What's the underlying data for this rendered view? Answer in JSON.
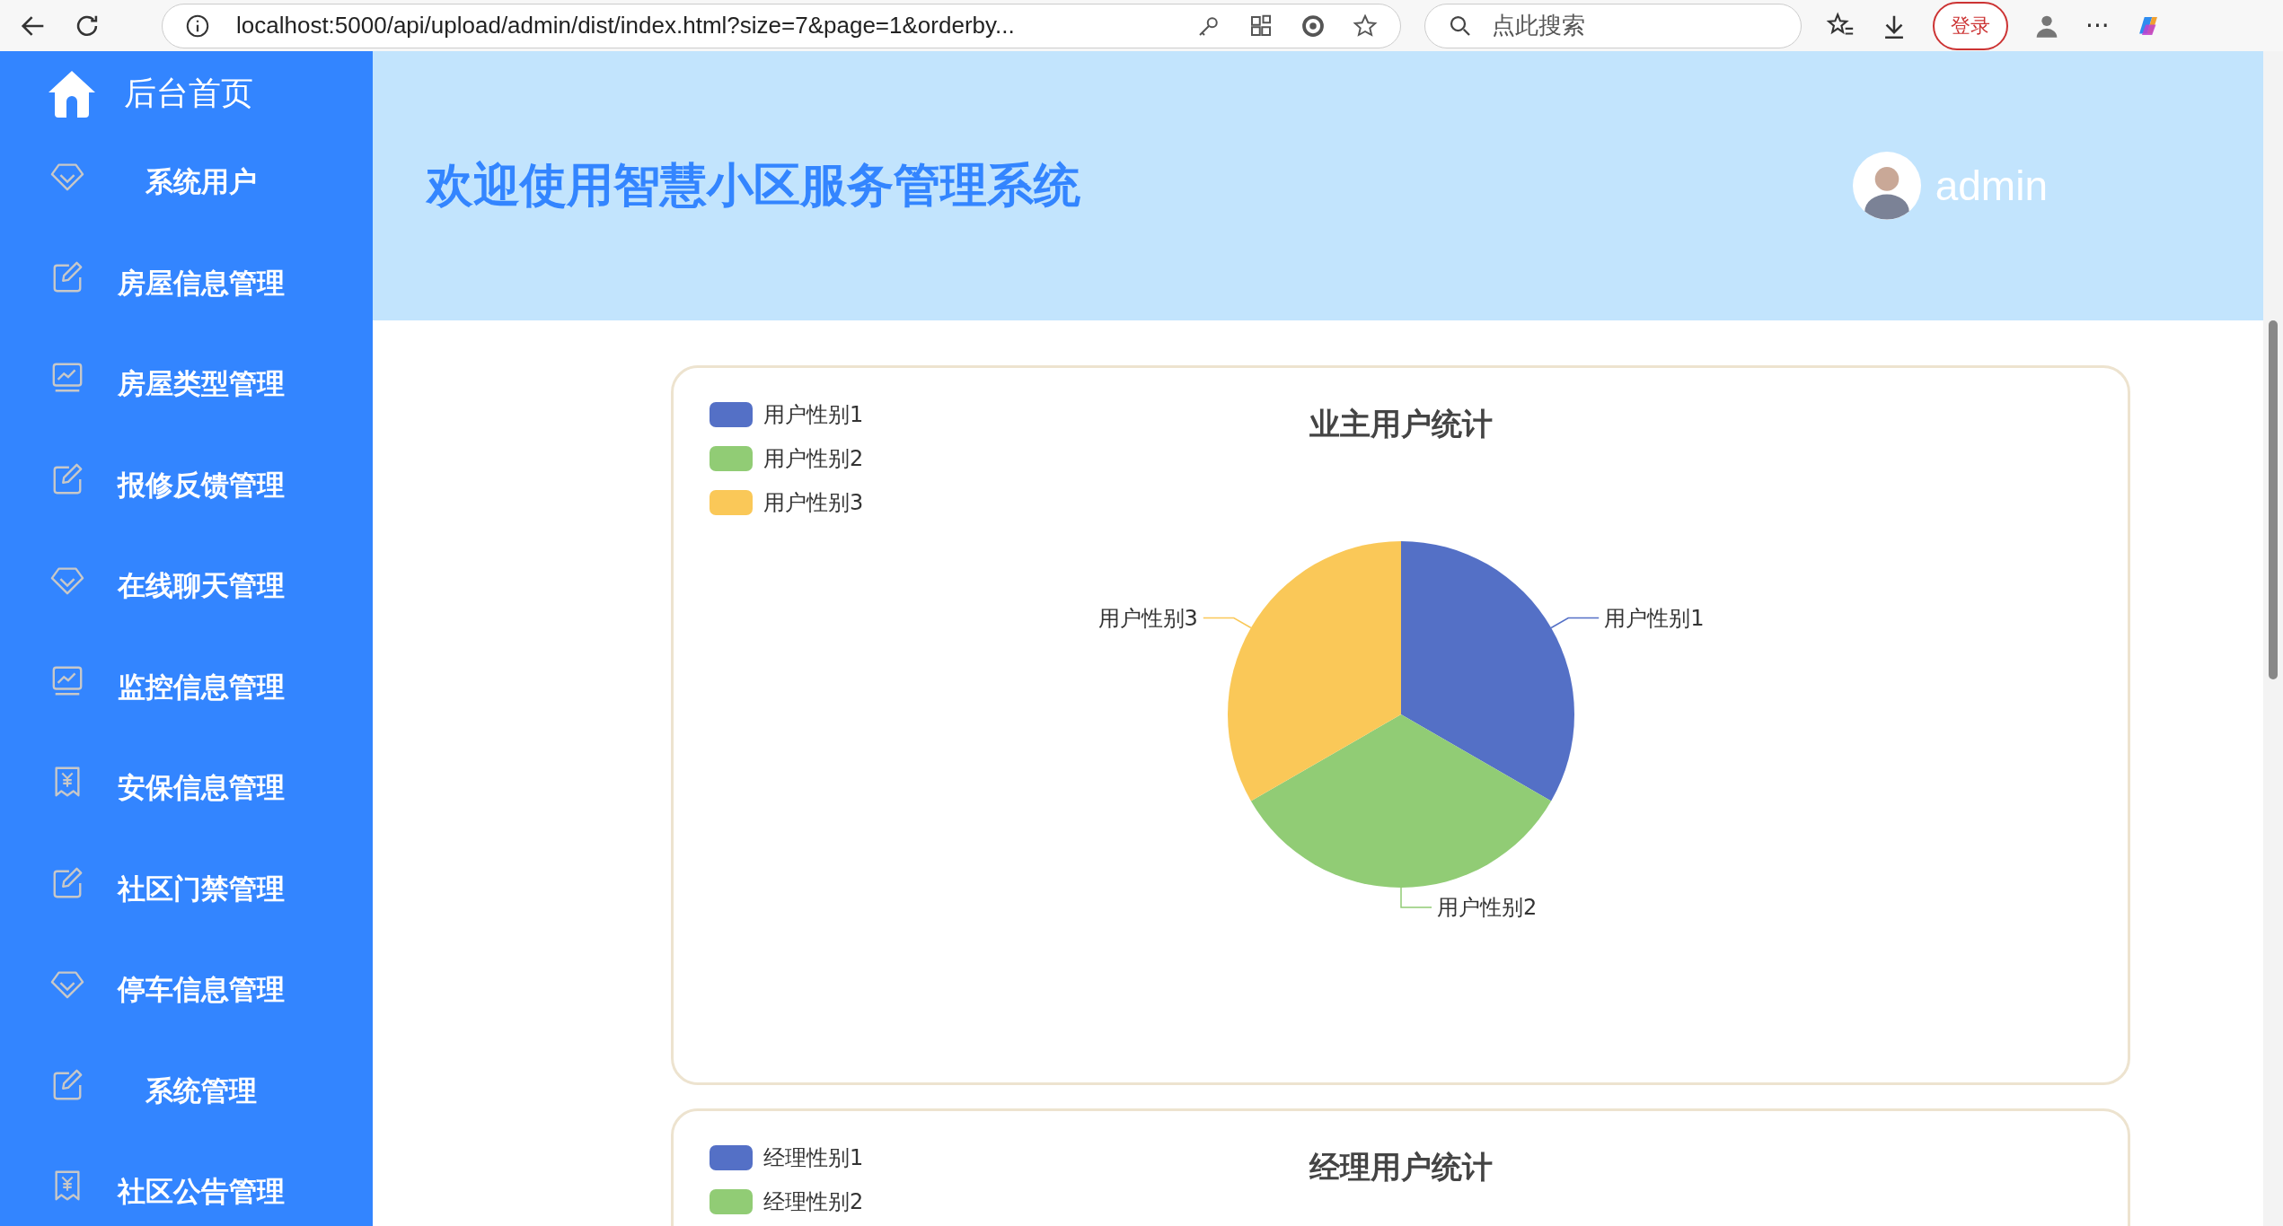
{
  "browser": {
    "url": "localhost:5000/api/upload/admin/dist/index.html?size=7&page=1&orderby...",
    "search_placeholder": "点此搜索",
    "login_button": "登录",
    "more": "···"
  },
  "sidebar": {
    "home": "后台首页",
    "items": [
      {
        "label": "系统用户",
        "kind": "diamond"
      },
      {
        "label": "房屋信息管理",
        "kind": "edit"
      },
      {
        "label": "房屋类型管理",
        "kind": "monitor"
      },
      {
        "label": "报修反馈管理",
        "kind": "edit"
      },
      {
        "label": "在线聊天管理",
        "kind": "diamond"
      },
      {
        "label": "监控信息管理",
        "kind": "monitor"
      },
      {
        "label": "安保信息管理",
        "kind": "receipt"
      },
      {
        "label": "社区门禁管理",
        "kind": "edit"
      },
      {
        "label": "停车信息管理",
        "kind": "diamond"
      },
      {
        "label": "系统管理",
        "kind": "edit"
      },
      {
        "label": "社区公告管理",
        "kind": "receipt"
      }
    ]
  },
  "header": {
    "title": "欢迎使用智慧小区服务管理系统",
    "user": "admin"
  },
  "charts": [
    {
      "title": "业主用户统计",
      "legend": [
        {
          "name": "用户性别1",
          "color": "#5470c6"
        },
        {
          "name": "用户性别2",
          "color": "#91cc75"
        },
        {
          "name": "用户性别3",
          "color": "#fac858"
        }
      ],
      "slice_labels": [
        "用户性别1",
        "用户性别2",
        "用户性别3"
      ]
    },
    {
      "title": "经理用户统计",
      "legend": [
        {
          "name": "经理性别1",
          "color": "#5470c6"
        },
        {
          "name": "经理性别2",
          "color": "#91cc75"
        }
      ]
    }
  ]
}
